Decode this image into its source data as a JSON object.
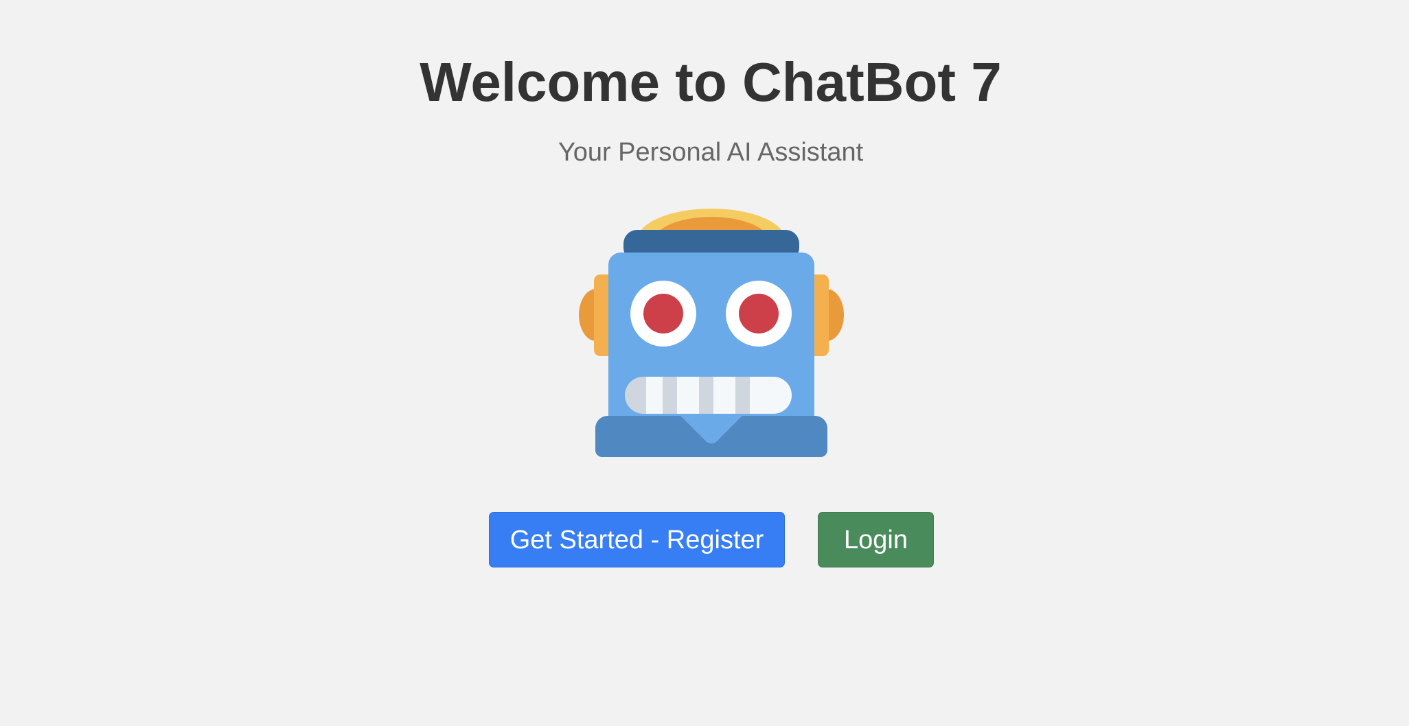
{
  "hero": {
    "title": "Welcome to ChatBot 7",
    "subtitle": "Your Personal AI Assistant",
    "illustration": "robot-face-icon"
  },
  "actions": {
    "register_label": "Get Started - Register",
    "login_label": "Login"
  },
  "colors": {
    "background": "#f2f2f2",
    "title": "#333333",
    "subtitle": "#666666",
    "register_button": "#377ef4",
    "login_button": "#4a8b5c",
    "robot_head": "#6aaae8",
    "robot_band": "#366799",
    "robot_body": "#5088c1",
    "robot_eye": "#cd3f49",
    "robot_ear": "#f4b04f"
  }
}
